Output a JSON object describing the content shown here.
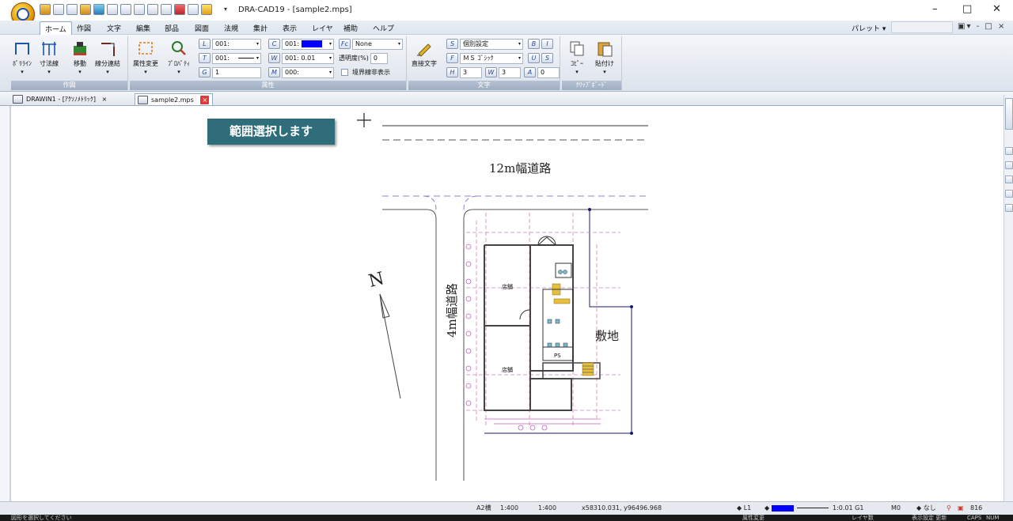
{
  "app": {
    "title": "DRA-CAD19 - [sample2.mps]",
    "qat_dropdown": "▾",
    "window_controls": {
      "minimize": "–",
      "restore": "□",
      "close": "✕"
    }
  },
  "menu": {
    "items": [
      "ホーム",
      "作図",
      "文字",
      "編集",
      "部品",
      "図面",
      "法規",
      "集計",
      "表示",
      "レイヤ",
      "補助",
      "ヘルプ"
    ],
    "palette": "パレット ▾",
    "right_tools": "▣▾ - □ ×"
  },
  "ribbon": {
    "groups": {
      "drawing": "作図",
      "attribute": "属性",
      "text": "文字",
      "clipboard": "ｸﾘｯﾌﾟﾎﾞｰﾄﾞ"
    },
    "buttons": {
      "polyline": "ﾎﾟﾘﾗｲﾝ",
      "dimension": "寸法線",
      "move": "移動",
      "line_connect": "線分連結",
      "attr_change": "属性変更",
      "property": "ﾌﾟﾛﾊﾟﾃｨ",
      "direct_text": "直接文字",
      "copy": "ｺﾋﾟｰ",
      "paste": "貼付け"
    },
    "attr": {
      "layer": "001:",
      "linetype": "001:",
      "group": "1",
      "color": "001:",
      "width": "001: 0.01",
      "mark": "000:",
      "fill": "None",
      "transparency_label": "透明度(%)",
      "transparency_value": "0",
      "boundary_label": "境界線非表示"
    },
    "text": {
      "style": "個別設定",
      "font": "ＭＳ ｺﾞｼｯｸ",
      "height": "3",
      "width": "3",
      "angle": "0"
    },
    "icon_letters": {
      "layer": "L",
      "linetype": "T",
      "group": "G",
      "color": "C",
      "width": "W",
      "mark": "M",
      "fill": "Fc",
      "style": "S",
      "font": "F",
      "height": "H",
      "twidth": "W",
      "angle": "A",
      "bold": "B",
      "italic": "I",
      "underline": "U",
      "strike": "S"
    }
  },
  "tabs": [
    {
      "label": "DRAWIN1 - [ｱｸｿﾉﾒﾄﾘｯｸ]",
      "close": "×"
    },
    {
      "label": "sample2.mps",
      "close": "×"
    }
  ],
  "canvas": {
    "tooltip": "範囲選択します",
    "road_12m": "12m幅道路",
    "road_4m": "4m幅道路",
    "site": "敷地",
    "north": "N",
    "room_1": "店舗",
    "room_2": "店舗",
    "ps": "PS"
  },
  "status": {
    "scale_label": "A2横",
    "scale_1": "1:400",
    "scale_2": "1:400",
    "coords": "x58310.031, y96496.968",
    "layer": "L1",
    "line_scale": "1:0.01 G1",
    "mark": "M0",
    "snap": "なし",
    "zoom": "816",
    "message": "図形を選択してください",
    "bottom_attr": "属性変更",
    "bottom_layer": "レイヤ数",
    "bottom_display": "表示設定 更新",
    "bottom_caps": "CAPS",
    "bottom_num": "NUM"
  }
}
